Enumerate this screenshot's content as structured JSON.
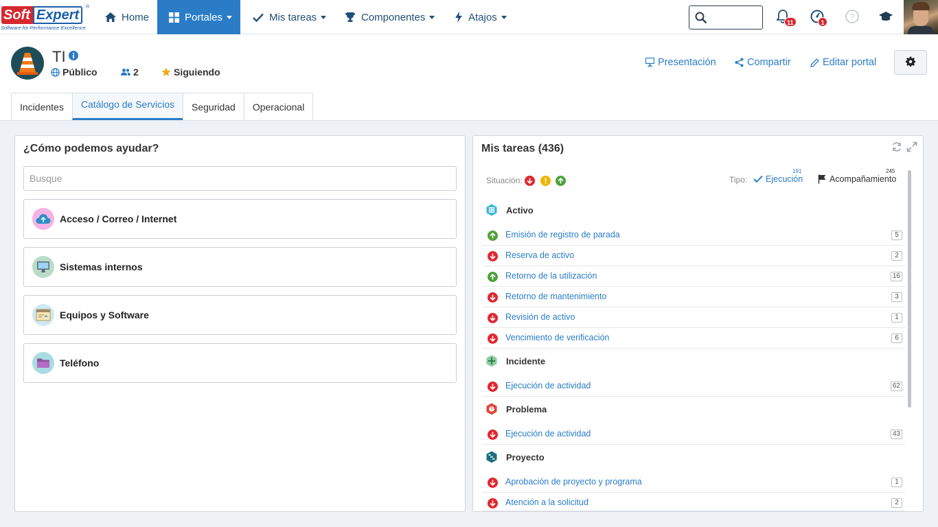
{
  "brand": {
    "name_part1": "Soft",
    "name_part2": "Expert",
    "registered": "®",
    "tagline": "Software for Performance Excellence"
  },
  "nav": {
    "home": "Home",
    "portales": "Portales",
    "mis_tareas": "Mis tareas",
    "componentes": "Componentes",
    "atajos": "Atajos",
    "search_placeholder": "",
    "notifications_count": "11",
    "tasks_alert_count": "1"
  },
  "portal": {
    "name": "TI",
    "visibility": "Público",
    "members": "2",
    "follow": "Siguiendo",
    "actions": {
      "presentation": "Presentación",
      "share": "Compartir",
      "edit": "Editar portal"
    },
    "tabs": [
      "Incidentes",
      "Catálogo de Servicios",
      "Seguridad",
      "Operacional"
    ],
    "active_tab": 1
  },
  "catalog": {
    "title": "¿Cómo podemos ayudar?",
    "search_placeholder": "Busque",
    "items": [
      {
        "label": "Acceso / Correo / Internet",
        "icon": "cloud-upload-icon"
      },
      {
        "label": "Sistemas internos",
        "icon": "computer-icon"
      },
      {
        "label": "Equipos y Software",
        "icon": "window-icon"
      },
      {
        "label": "Teléfono",
        "icon": "folder-icon"
      }
    ]
  },
  "tasks": {
    "title": "Mis tareas (436)",
    "situacion_label": "Situación:",
    "tipo_label": "Tipo:",
    "tipo_ejecucion": "Ejecución",
    "tipo_ejecucion_count": "191",
    "tipo_acompanamiento": "Acompañamiento",
    "tipo_acompanamiento_count": "245",
    "colors": {
      "late": "#e0262f",
      "warning": "#f0b400",
      "ok": "#4ea13a",
      "link": "#2a7cc7"
    },
    "groups": [
      {
        "name": "Activo",
        "icon": "building-icon",
        "rows": [
          {
            "label": "Emisión de registro de parada",
            "status": "ok",
            "count": "5"
          },
          {
            "label": "Reserva de activo",
            "status": "late",
            "count": "2"
          },
          {
            "label": "Retorno de la utilización",
            "status": "ok",
            "count": "16"
          },
          {
            "label": "Retorno de mantenimiento",
            "status": "late",
            "count": "3"
          },
          {
            "label": "Revisión de activo",
            "status": "late",
            "count": "1"
          },
          {
            "label": "Vencimiento de verificación",
            "status": "late",
            "count": "6"
          }
        ]
      },
      {
        "name": "Incidente",
        "icon": "incident-icon",
        "rows": [
          {
            "label": "Ejecución de actividad",
            "status": "late",
            "count": "62"
          }
        ]
      },
      {
        "name": "Problema",
        "icon": "problem-icon",
        "rows": [
          {
            "label": "Ejecución de actividad",
            "status": "late",
            "count": "43"
          }
        ]
      },
      {
        "name": "Proyecto",
        "icon": "project-icon",
        "rows": [
          {
            "label": "Aprobación de proyecto y programa",
            "status": "late",
            "count": "1"
          },
          {
            "label": "Atención a la solicitud",
            "status": "late",
            "count": "2"
          }
        ]
      }
    ]
  }
}
